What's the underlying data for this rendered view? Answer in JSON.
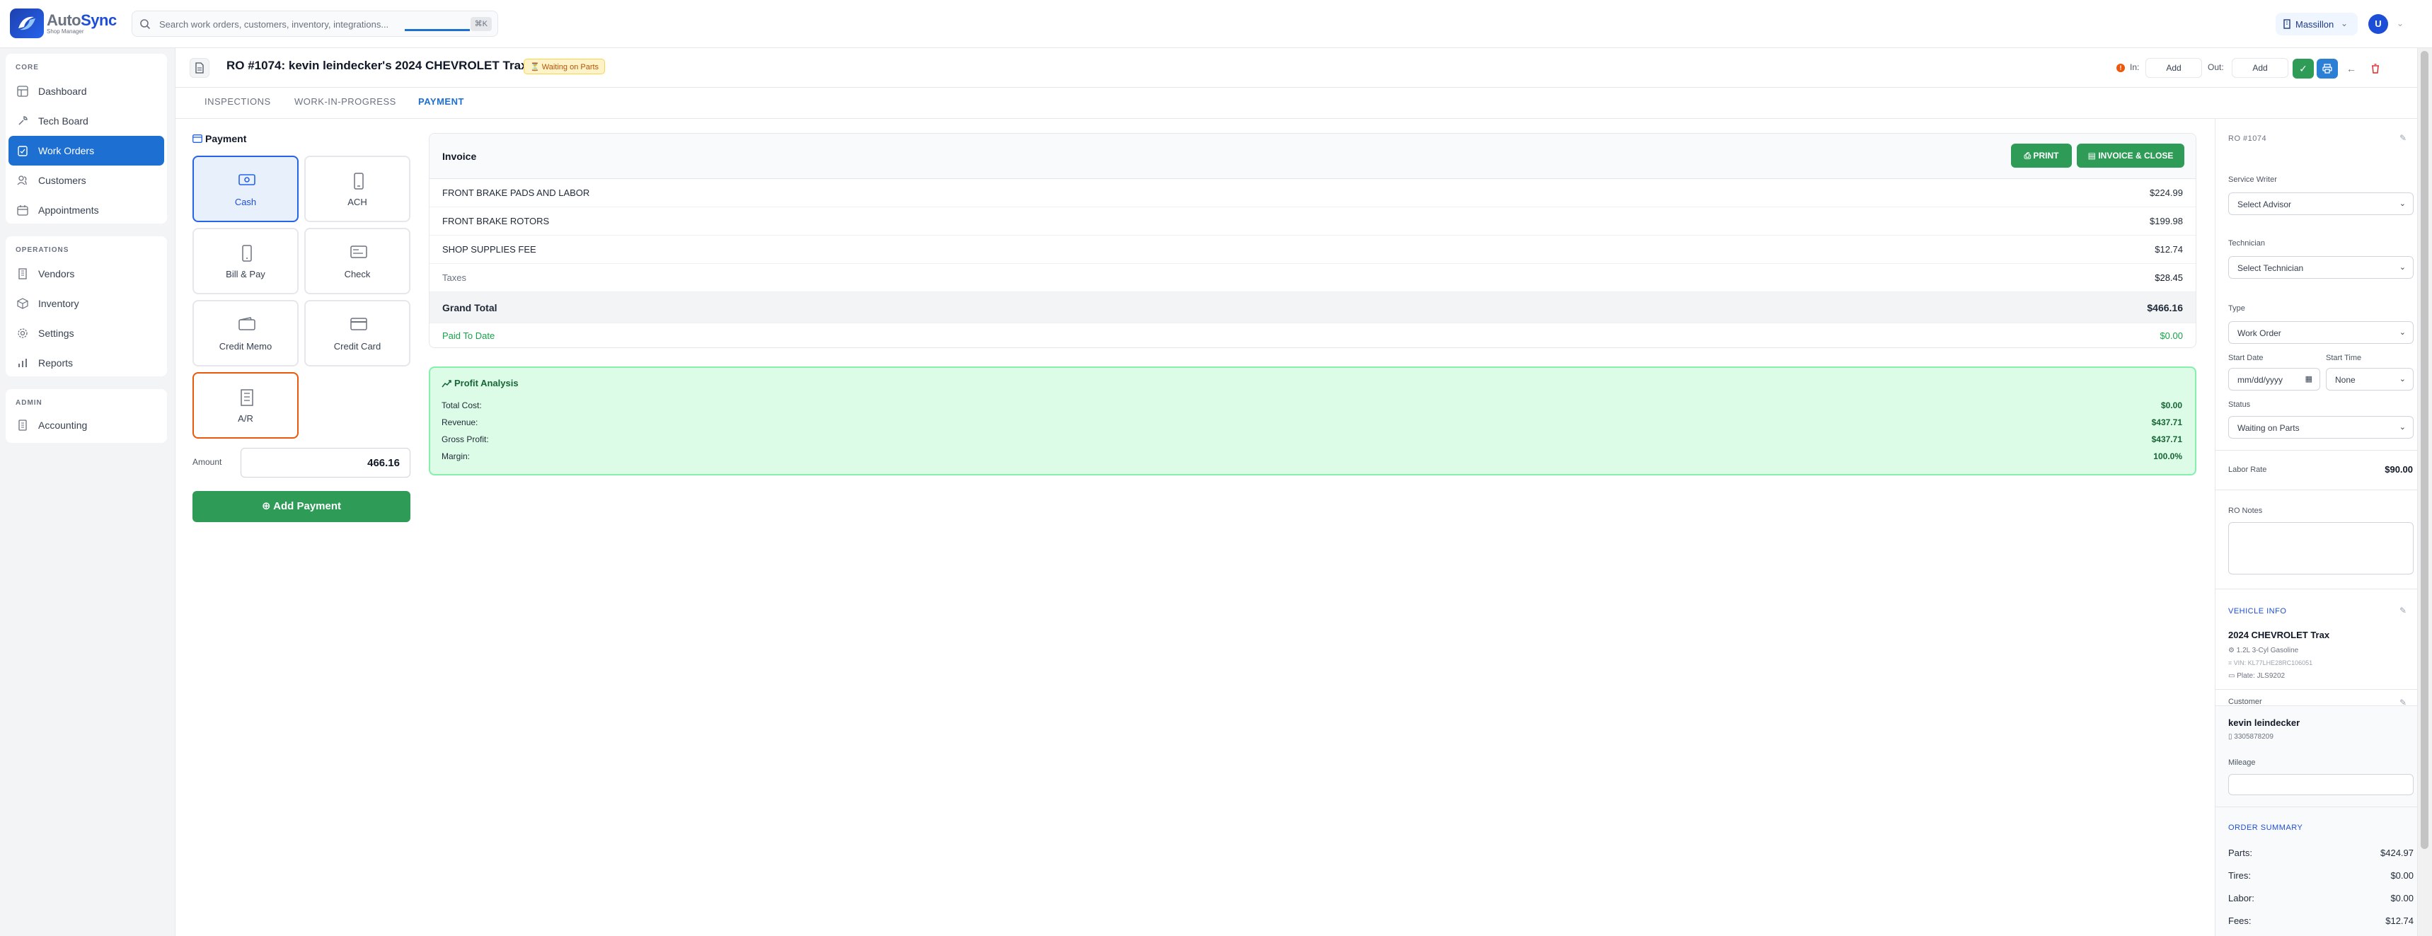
{
  "app": {
    "name_part1": "Auto",
    "name_part2": "Sync",
    "subtitle": "Shop Manager",
    "search_placeholder": "Search work orders, customers, inventory, integrations...",
    "search_shortcut": "⌘K",
    "location": "Massillon",
    "user_initial": "U"
  },
  "sidebar": {
    "core_heading": "CORE",
    "core_items": [
      {
        "label": "Dashboard",
        "icon": "grid-icon"
      },
      {
        "label": "Tech Board",
        "icon": "wrench-icon"
      },
      {
        "label": "Work Orders",
        "icon": "clipboard-icon",
        "active": true
      },
      {
        "label": "Customers",
        "icon": "users-icon"
      },
      {
        "label": "Appointments",
        "icon": "calendar-icon"
      }
    ],
    "operations_heading": "OPERATIONS",
    "operations_items": [
      {
        "label": "Vendors",
        "icon": "building-icon"
      },
      {
        "label": "Inventory",
        "icon": "box-icon"
      },
      {
        "label": "Settings",
        "icon": "gear-icon"
      },
      {
        "label": "Reports",
        "icon": "bar-chart-icon"
      }
    ],
    "admin_heading": "ADMIN",
    "admin_items": [
      {
        "label": "Accounting",
        "icon": "ledger-icon"
      }
    ]
  },
  "ro": {
    "title": "RO #1074: kevin leindecker's 2024 CHEVROLET Trax",
    "status_badge": "⏳ Waiting on Parts",
    "in_label": "In:",
    "in_button": "Add",
    "out_label": "Out:",
    "out_button": "Add"
  },
  "tabs": [
    "INSPECTIONS",
    "WORK-IN-PROGRESS",
    "PAYMENT"
  ],
  "payment": {
    "title": "Payment",
    "methods": [
      {
        "label": "Cash",
        "icon": "cash-icon"
      },
      {
        "label": "ACH",
        "icon": "phone-icon"
      },
      {
        "label": "Bill & Pay",
        "icon": "mobile-icon"
      },
      {
        "label": "Check",
        "icon": "check-icon"
      },
      {
        "label": "Credit Memo",
        "icon": "wallet-icon"
      },
      {
        "label": "Credit Card",
        "icon": "credit-card-icon"
      },
      {
        "label": "A/R",
        "icon": "building-icon"
      }
    ],
    "amount_label": "Amount",
    "amount_value": "466.16",
    "add_button": "Add Payment"
  },
  "invoice": {
    "title": "Invoice",
    "print_button": "PRINT",
    "invoice_close_button": "INVOICE & CLOSE",
    "lines": [
      {
        "name": "FRONT BRAKE PADS AND LABOR",
        "value": "$224.99"
      },
      {
        "name": "FRONT BRAKE ROTORS",
        "value": "$199.98"
      },
      {
        "name": "SHOP SUPPLIES FEE",
        "value": "$12.74"
      }
    ],
    "taxes_label": "Taxes",
    "taxes_value": "$28.45",
    "grand_total_label": "Grand Total",
    "grand_total_value": "$466.16",
    "paid_label": "Paid To Date",
    "paid_value": "$0.00"
  },
  "profit": {
    "title": "Profit Analysis",
    "rows": [
      {
        "label": "Total Cost:",
        "value": "$0.00"
      },
      {
        "label": "Revenue:",
        "value": "$437.71"
      },
      {
        "label": "Gross Profit:",
        "value": "$437.71"
      },
      {
        "label": "Margin:",
        "value": "100.0%"
      }
    ]
  },
  "right_panel": {
    "ro_number": "RO #1074",
    "service_writer_label": "Service Writer",
    "service_writer_value": "Select Advisor",
    "technician_label": "Technician",
    "technician_value": "Select Technician",
    "type_label": "Type",
    "type_value": "Work Order",
    "start_date_label": "Start Date",
    "start_date_placeholder": "mm/dd/yyyy",
    "start_time_label": "Start Time",
    "start_time_value": "None",
    "status_label": "Status",
    "status_value": "Waiting on Parts",
    "labor_rate_label": "Labor Rate",
    "labor_rate_value": "$90.00",
    "notes_label": "RO Notes",
    "vehicle_heading": "VEHICLE INFO",
    "vehicle_name": "2024 CHEVROLET Trax",
    "vehicle_engine": "1.2L 3-Cyl Gasoline",
    "vehicle_vin": "VIN: KL77LHE28RC106051",
    "vehicle_plate": "Plate: JLS9202",
    "customer_label": "Customer",
    "customer_name": "kevin leindecker",
    "customer_phone": "3305878209",
    "mileage_label": "Mileage",
    "summary_heading": "ORDER SUMMARY",
    "summary": [
      {
        "label": "Parts:",
        "value": "$424.97"
      },
      {
        "label": "Tires:",
        "value": "$0.00"
      },
      {
        "label": "Labor:",
        "value": "$0.00"
      },
      {
        "label": "Fees:",
        "value": "$12.74"
      }
    ]
  },
  "colors": {
    "primary": "#1d6fd1",
    "success": "#2e9c57",
    "warning": "#ea580c",
    "danger": "#dc2626"
  }
}
